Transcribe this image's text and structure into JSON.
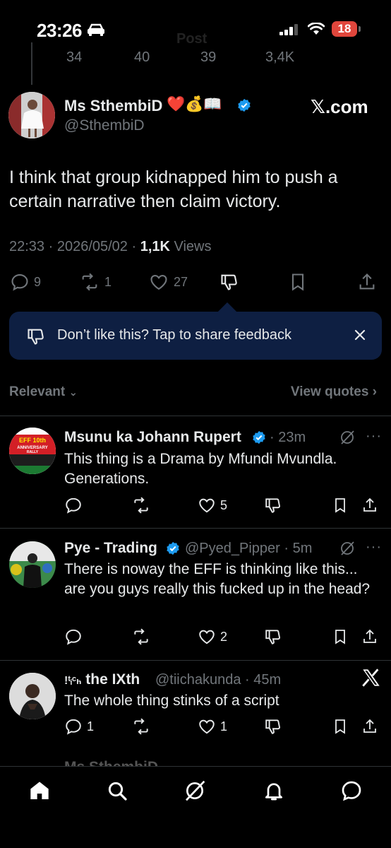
{
  "status_bar": {
    "time": "23:26",
    "battery": "18"
  },
  "header_faded": "Post",
  "prev_actions": {
    "replies": "34",
    "reposts": "40",
    "likes": "39",
    "views": "3,4K"
  },
  "main_tweet": {
    "author_name": "Ms SthembiD",
    "author_emoji": "❤️💰📖",
    "author_handle": "@SthembiD",
    "brand": "𝕏.com",
    "text": "I think that group kidnapped him to push a certain narrative then claim victory.",
    "time": "22:33 · 2026/05/02 · ",
    "views_count": "1,1K",
    "views_label": " Views",
    "replies": "9",
    "reposts": "1",
    "likes": "27"
  },
  "feedback_banner": {
    "text": "Don’t like this? Tap to share feedback"
  },
  "replies_header": {
    "sort": "Relevant",
    "quotes": "View quotes"
  },
  "replies": [
    {
      "name": "Msunu ka Johann Rupert",
      "handle": "· 23m",
      "text": "This thing is a Drama by Mfundi Mvundla. Generations.",
      "replies": "",
      "reposts": "",
      "likes": "5",
      "avatar_text": "EFF 10th ANNIVERSARY RALLY"
    },
    {
      "name": "Pye - Trading",
      "handle": "@Pyed_Pipper · 5m",
      "text": "There is noway the EFF is thinking like this... are you guys really this fucked up in the head?",
      "replies": "",
      "reposts": "",
      "likes": "2"
    },
    {
      "name_prefix": "!ᵗᵢᶜₕ",
      "name": "the IXth",
      "handle": "@tiichakunda · 45m",
      "text": "The whole thing stinks of a script",
      "replies": "1",
      "reposts": "",
      "likes": "1"
    }
  ],
  "peek_name": "Ms SthembiD",
  "colors": {
    "background": "#000000",
    "verified": "#1d9bf0",
    "banner": "#0e1f42",
    "muted": "#71767b",
    "battery": "#e0463c"
  }
}
